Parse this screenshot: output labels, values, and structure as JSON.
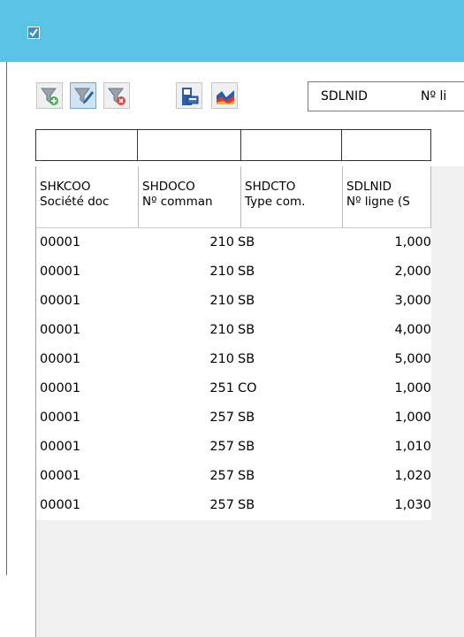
{
  "window": {
    "icon": "checkbox-app-icon"
  },
  "toolbar": {
    "buttons": [
      {
        "name": "add-filter-button",
        "icon": "funnel-plus-icon"
      },
      {
        "name": "edit-filter-button",
        "icon": "funnel-pen-icon"
      },
      {
        "name": "remove-filter-button",
        "icon": "funnel-x-icon"
      },
      {
        "name": "print-button",
        "icon": "printer-icon"
      },
      {
        "name": "chart-button",
        "icon": "area-chart-icon"
      }
    ],
    "combo": {
      "code": "SDLNID",
      "label": "Nº li"
    }
  },
  "columns": [
    {
      "code": "SHKCOO",
      "label": "Société doc"
    },
    {
      "code": "SHDOCO",
      "label": "Nº comman"
    },
    {
      "code": "SHDCTO",
      "label": "Type com."
    },
    {
      "code": "SDLNID",
      "label": "Nº ligne (S"
    }
  ],
  "rows": [
    [
      "00001",
      "210",
      "SB",
      "1,000"
    ],
    [
      "00001",
      "210",
      "SB",
      "2,000"
    ],
    [
      "00001",
      "210",
      "SB",
      "3,000"
    ],
    [
      "00001",
      "210",
      "SB",
      "4,000"
    ],
    [
      "00001",
      "210",
      "SB",
      "5,000"
    ],
    [
      "00001",
      "251",
      "CO",
      "1,000"
    ],
    [
      "00001",
      "257",
      "SB",
      "1,000"
    ],
    [
      "00001",
      "257",
      "SB",
      "1,010"
    ],
    [
      "00001",
      "257",
      "SB",
      "1,020"
    ],
    [
      "00001",
      "257",
      "SB",
      "1,030"
    ]
  ],
  "colors": {
    "titlebar": "#5ac4e6",
    "accent_blue": "#2a5caa",
    "chart_red": "#e03a2a"
  }
}
